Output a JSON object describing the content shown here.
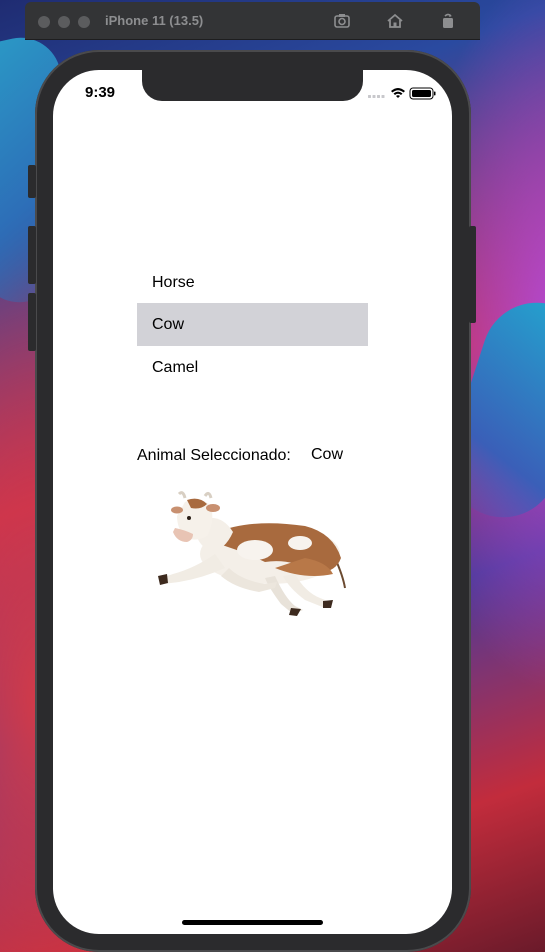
{
  "window": {
    "title": "iPhone 11 (13.5)"
  },
  "status_bar": {
    "time": "9:39",
    "icons": [
      "signal-icon",
      "wifi-icon",
      "battery-icon"
    ]
  },
  "picker": {
    "options": [
      "Horse",
      "Cow",
      "Camel"
    ],
    "selected": "Cow"
  },
  "selection": {
    "label": "Animal Seleccionado:",
    "value": "Cow"
  },
  "image": {
    "icon": "cow-image"
  },
  "colors": {
    "selected_row": "#d2d2d7",
    "titlebar": "#333436",
    "device": "#2b2b2d"
  }
}
